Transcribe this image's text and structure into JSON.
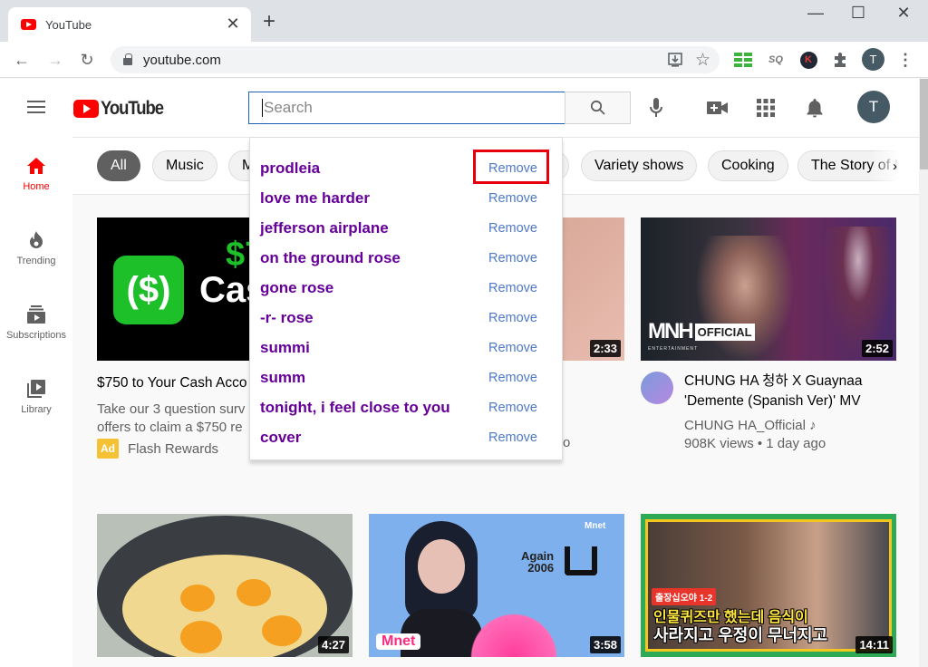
{
  "browser": {
    "tab_title": "YouTube",
    "new_tab_label": "+",
    "url": "youtube.com",
    "window_controls": {
      "minimize": "—",
      "maximize": "☐",
      "close": "✕"
    },
    "profile_initial": "T",
    "extensions": [
      "green-grid-extension",
      "sq-extension",
      "k-extension",
      "extensions-puzzle"
    ]
  },
  "header": {
    "logo_text": "YouTube",
    "search": {
      "placeholder": "Search",
      "value": ""
    },
    "avatar_initial": "T"
  },
  "sidebar": {
    "items": [
      {
        "label": "Home",
        "icon": "home-icon",
        "active": true
      },
      {
        "label": "Trending",
        "icon": "flame-icon",
        "active": false
      },
      {
        "label": "Subscriptions",
        "icon": "subscriptions-icon",
        "active": false
      },
      {
        "label": "Library",
        "icon": "library-icon",
        "active": false
      }
    ]
  },
  "chips": [
    {
      "label": "All",
      "active": true
    },
    {
      "label": "Music"
    },
    {
      "label": "M"
    },
    {
      "label": "Variety shows"
    },
    {
      "label": "Cooking"
    },
    {
      "label": "The Story of Mind"
    }
  ],
  "search_suggestions": {
    "remove_label": "Remove",
    "highlighted_index": 0,
    "items": [
      "prodleia",
      "love me harder",
      "jefferson airplane",
      "on the ground rose",
      "gone rose",
      "-r- rose",
      "summi",
      "summ",
      "tonight, i feel close to you",
      "cover"
    ]
  },
  "videos": [
    {
      "title": "$750 to Your Cash Acco",
      "description": [
        "Take our 3 question surv",
        "offers to claim a $750 re"
      ],
      "ad_badge": "Ad",
      "channel": "Flash Rewards",
      "thumb_text": {
        "big": "Cas",
        "green": "$7"
      }
    },
    {
      "duration": "2:33",
      "partial_text": "o"
    },
    {
      "title": "CHUNG HA 청하 X Guaynaa 'Demente (Spanish Ver)' MV",
      "channel": "CHUNG HA_Official",
      "channel_badge": "♪",
      "stats": "908K views • 1 day ago",
      "duration": "2:52",
      "thumb_text": {
        "logo": "MNH",
        "logo_tag": "OFFICIAL",
        "sub": "ENTERTAINMENT"
      }
    },
    {
      "duration": "4:27"
    },
    {
      "duration": "3:58",
      "thumb_text": {
        "line1": "Again",
        "line2": "2006",
        "glyph": "U",
        "brand": "Mnet"
      }
    },
    {
      "duration": "14:11",
      "thumb_text": {
        "tag": "출장십오야 1-2",
        "line1": "인물퀴즈만 했는데 음식이",
        "line2": "사라지고 우정이 무너지고"
      }
    }
  ]
}
